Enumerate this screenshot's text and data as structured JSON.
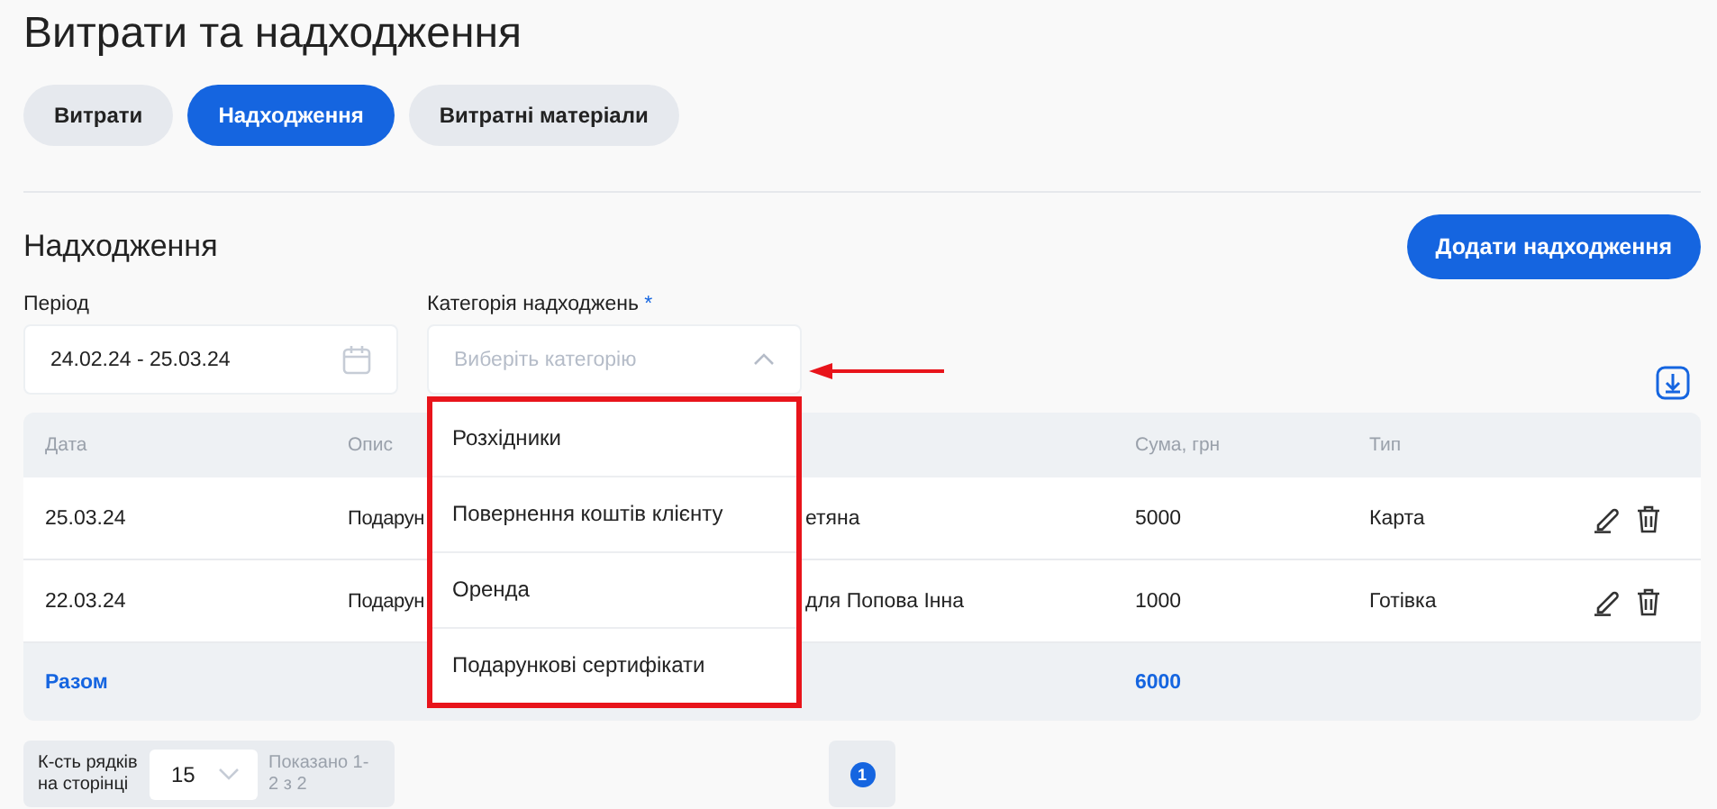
{
  "page_title": "Витрати та надходження",
  "tabs": [
    {
      "label": "Витрати",
      "selected": false
    },
    {
      "label": "Надходження",
      "selected": true
    },
    {
      "label": "Витратні матеріали",
      "selected": false
    }
  ],
  "section_title": "Надходження",
  "add_button": "Додати надходження",
  "filters": {
    "period": {
      "label": "Період",
      "value": "24.02.24 - 25.03.24"
    },
    "category": {
      "label": "Категорія надходжень",
      "required_mark": "*",
      "placeholder": "Виберіть категорію",
      "expanded": true,
      "options": [
        "Розхідники",
        "Повернення коштів клієнту",
        "Оренда",
        "Подарункові сертифікати"
      ]
    }
  },
  "table": {
    "columns": [
      "Дата",
      "Опис",
      "",
      "Сума, грн",
      "Тип"
    ],
    "rows": [
      [
        "25.03.24",
        "Подарун",
        "етяна",
        "5000",
        "Карта"
      ],
      [
        "22.03.24",
        "Подарун",
        "для Попова Інна",
        "1000",
        "Готівка"
      ]
    ],
    "total": {
      "label": "Разом",
      "amount": "6000"
    }
  },
  "pagination": {
    "rows_label": "К-сть рядків на сторінці",
    "page_size": "15",
    "shown": "Показано 1-2 з 2",
    "pages": [
      {
        "label": "1",
        "selected": true
      }
    ]
  }
}
